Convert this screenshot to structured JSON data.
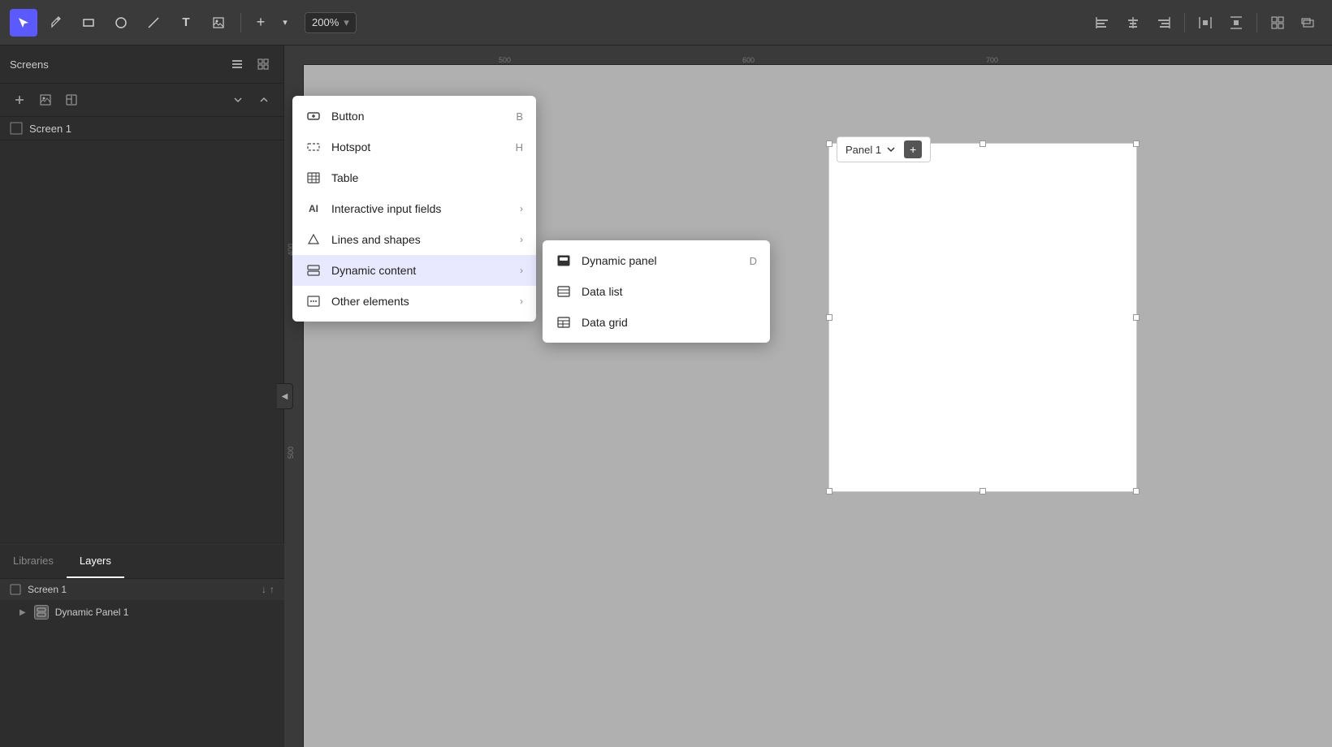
{
  "toolbar": {
    "tools": [
      {
        "name": "select-tool",
        "label": "▲",
        "active": true,
        "shortcut": ""
      },
      {
        "name": "pen-tool",
        "label": "✒",
        "active": false
      },
      {
        "name": "rectangle-tool",
        "label": "▭",
        "active": false
      },
      {
        "name": "ellipse-tool",
        "label": "○",
        "active": false
      },
      {
        "name": "line-tool",
        "label": "╱",
        "active": false
      },
      {
        "name": "text-tool",
        "label": "T",
        "active": false
      },
      {
        "name": "image-tool",
        "label": "⊡",
        "active": false
      }
    ],
    "add_button": "+",
    "add_dropdown": "▾",
    "zoom_value": "200%",
    "zoom_dropdown": "▾",
    "right_tools": [
      "⊞",
      "⊟",
      "⊡",
      "↔",
      "↕",
      "⊠",
      "⊟",
      "⊡"
    ]
  },
  "screens_panel": {
    "title": "Screens",
    "screens": [
      {
        "name": "Screen 1",
        "id": "screen-1"
      }
    ]
  },
  "layers_panel": {
    "tabs": [
      "Libraries",
      "Layers"
    ],
    "active_tab": "Layers",
    "screen_name": "Screen 1",
    "items": [
      {
        "name": "Dynamic Panel 1",
        "type": "dynamic-panel",
        "expanded": false
      }
    ]
  },
  "add_menu": {
    "items": [
      {
        "name": "Button",
        "shortcut": "B",
        "icon": "button-icon",
        "has_submenu": false
      },
      {
        "name": "Hotspot",
        "shortcut": "H",
        "icon": "hotspot-icon",
        "has_submenu": false
      },
      {
        "name": "Table",
        "shortcut": "",
        "icon": "table-icon",
        "has_submenu": false
      },
      {
        "name": "Interactive input fields",
        "shortcut": "",
        "icon": "ai-icon",
        "has_submenu": true
      },
      {
        "name": "Lines and shapes",
        "shortcut": "",
        "icon": "shapes-icon",
        "has_submenu": true
      },
      {
        "name": "Dynamic content",
        "shortcut": "",
        "icon": "dynamic-icon",
        "has_submenu": true,
        "active": true
      },
      {
        "name": "Other elements",
        "shortcut": "",
        "icon": "other-icon",
        "has_submenu": true
      }
    ]
  },
  "dynamic_submenu": {
    "items": [
      {
        "name": "Dynamic panel",
        "shortcut": "D",
        "icon": "dynamic-panel-icon"
      },
      {
        "name": "Data list",
        "shortcut": "",
        "icon": "data-list-icon"
      },
      {
        "name": "Data grid",
        "shortcut": "",
        "icon": "data-grid-icon"
      }
    ]
  },
  "canvas": {
    "panel_label": "Panel 1"
  },
  "ruler": {
    "ticks": [
      "500",
      "600",
      "700"
    ]
  }
}
